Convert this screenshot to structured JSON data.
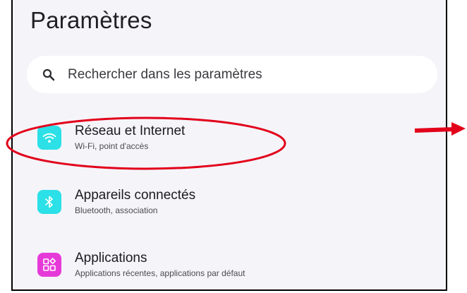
{
  "header": {
    "title": "Paramètres"
  },
  "search": {
    "placeholder": "Rechercher dans les paramètres",
    "icon": "search-icon"
  },
  "settings_items": [
    {
      "title": "Réseau et Internet",
      "subtitle": "Wi-Fi, point d'accès",
      "icon": "wifi-icon",
      "icon_color": "#2be0e7"
    },
    {
      "title": "Appareils connectés",
      "subtitle": "Bluetooth, association",
      "icon": "bluetooth-icon",
      "icon_color": "#2be0e7"
    },
    {
      "title": "Applications",
      "subtitle": "Applications récentes, applications par défaut",
      "icon": "apps-icon",
      "icon_color": "#e63ad8"
    }
  ],
  "annotations": {
    "highlight_color": "#e2001a",
    "arrow_color": "#e2001a"
  }
}
